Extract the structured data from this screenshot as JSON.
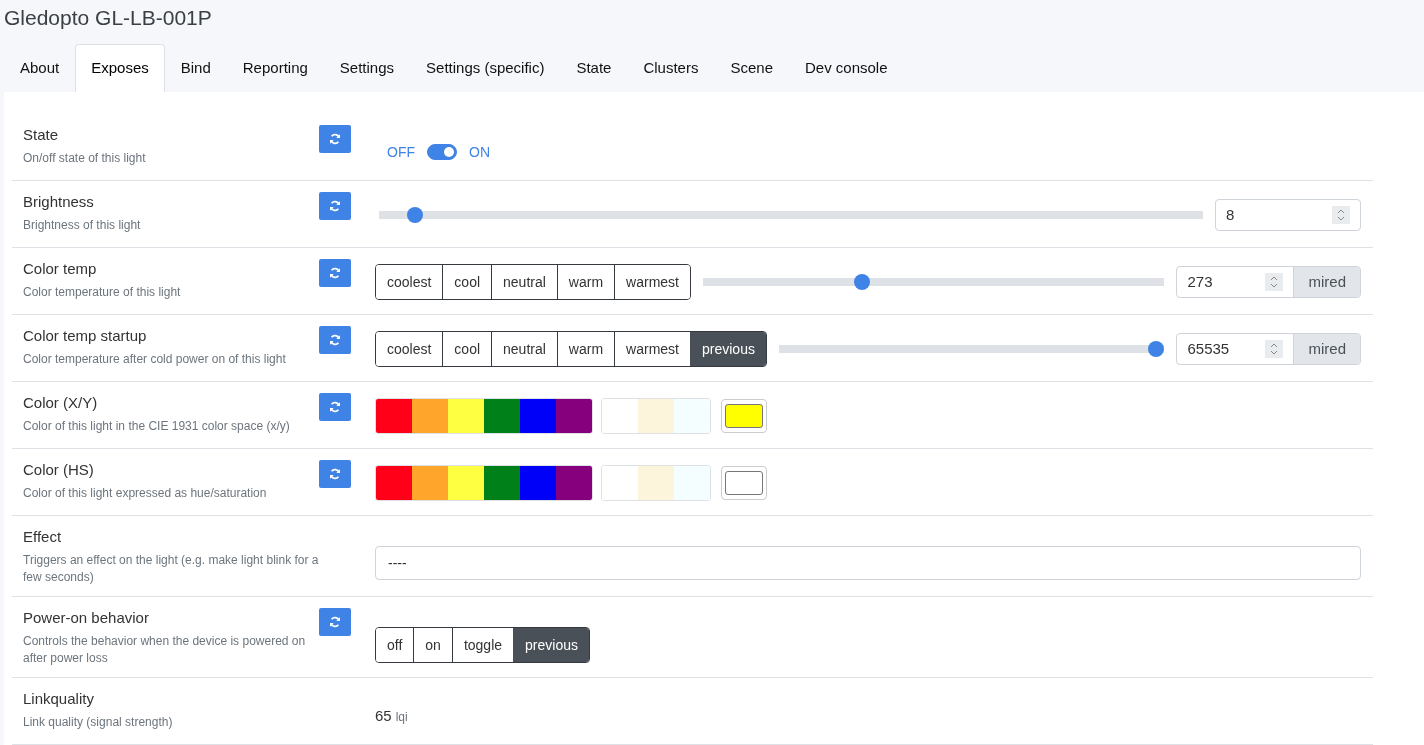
{
  "title": "Gledopto GL-LB-001P",
  "tabs": [
    {
      "label": "About",
      "selected": false
    },
    {
      "label": "Exposes",
      "selected": true
    },
    {
      "label": "Bind",
      "selected": false
    },
    {
      "label": "Reporting",
      "selected": false
    },
    {
      "label": "Settings",
      "selected": false
    },
    {
      "label": "Settings (specific)",
      "selected": false
    },
    {
      "label": "State",
      "selected": false
    },
    {
      "label": "Clusters",
      "selected": false
    },
    {
      "label": "Scene",
      "selected": false
    },
    {
      "label": "Dev console",
      "selected": false
    }
  ],
  "rows": [
    {
      "kind": "toggle",
      "name": "State",
      "description": "On/off state of this light",
      "refresh": true,
      "off_label": "OFF",
      "on_label": "ON",
      "on": true
    },
    {
      "kind": "slider",
      "name": "Brightness",
      "description": "Brightness of this light",
      "refresh": true,
      "level": 0.035,
      "value": "8"
    },
    {
      "kind": "slider",
      "name": "Color temp",
      "description": "Color temperature of this light",
      "refresh": true,
      "presets": [
        {
          "label": "coolest",
          "selected": false
        },
        {
          "label": "cool",
          "selected": false
        },
        {
          "label": "neutral",
          "selected": false
        },
        {
          "label": "warm",
          "selected": false
        },
        {
          "label": "warmest",
          "selected": false
        }
      ],
      "level": 0.34,
      "value": "273",
      "unit": "mired"
    },
    {
      "kind": "slider",
      "name": "Color temp startup",
      "description": "Color temperature after cold power on of this light",
      "refresh": true,
      "presets": [
        {
          "label": "coolest",
          "selected": false
        },
        {
          "label": "cool",
          "selected": false
        },
        {
          "label": "neutral",
          "selected": false
        },
        {
          "label": "warm",
          "selected": false
        },
        {
          "label": "warmest",
          "selected": false
        },
        {
          "label": "previous",
          "selected": true
        }
      ],
      "level": 1,
      "value": "65535",
      "unit": "mired"
    },
    {
      "kind": "color",
      "name": "Color (X/Y)",
      "description": "Color of this light in the CIE 1931 color space (x/y)",
      "refresh": true,
      "palette": [
        {
          "color": "#ff0018"
        },
        {
          "color": "#ffa52c"
        },
        {
          "color": "#ffff41"
        },
        {
          "color": "#008018"
        },
        {
          "color": "#0000f9"
        },
        {
          "color": "#86007d"
        }
      ],
      "whites": [
        {
          "color": "#ffffff"
        },
        {
          "color": "#fdf4dc"
        },
        {
          "color": "#f4fdff"
        }
      ],
      "current": {
        "color": "#ffff00"
      }
    },
    {
      "kind": "color",
      "name": "Color (HS)",
      "description": "Color of this light expressed as hue/saturation",
      "refresh": true,
      "palette": [
        {
          "color": "#ff0018"
        },
        {
          "color": "#ffa52c"
        },
        {
          "color": "#ffff41"
        },
        {
          "color": "#008018"
        },
        {
          "color": "#0000f9"
        },
        {
          "color": "#86007d"
        }
      ],
      "whites": [
        {
          "color": "#ffffff"
        },
        {
          "color": "#fdf4dc"
        },
        {
          "color": "#f4fdff"
        }
      ],
      "current": {
        "color": "#ffffff"
      }
    },
    {
      "kind": "select",
      "name": "Effect",
      "description": "Triggers an effect on the light (e.g. make light blink for a few seconds)",
      "refresh": false,
      "value": "----"
    },
    {
      "kind": "enum",
      "name": "Power-on behavior",
      "description": "Controls the behavior when the device is powered on after power loss",
      "refresh": true,
      "options": [
        {
          "label": "off",
          "selected": false
        },
        {
          "label": "on",
          "selected": false
        },
        {
          "label": "toggle",
          "selected": false
        },
        {
          "label": "previous",
          "selected": true
        }
      ]
    },
    {
      "kind": "reading",
      "name": "Linkquality",
      "description": "Link quality (signal strength)",
      "refresh": false,
      "value": "65",
      "unit": "lqi"
    }
  ]
}
